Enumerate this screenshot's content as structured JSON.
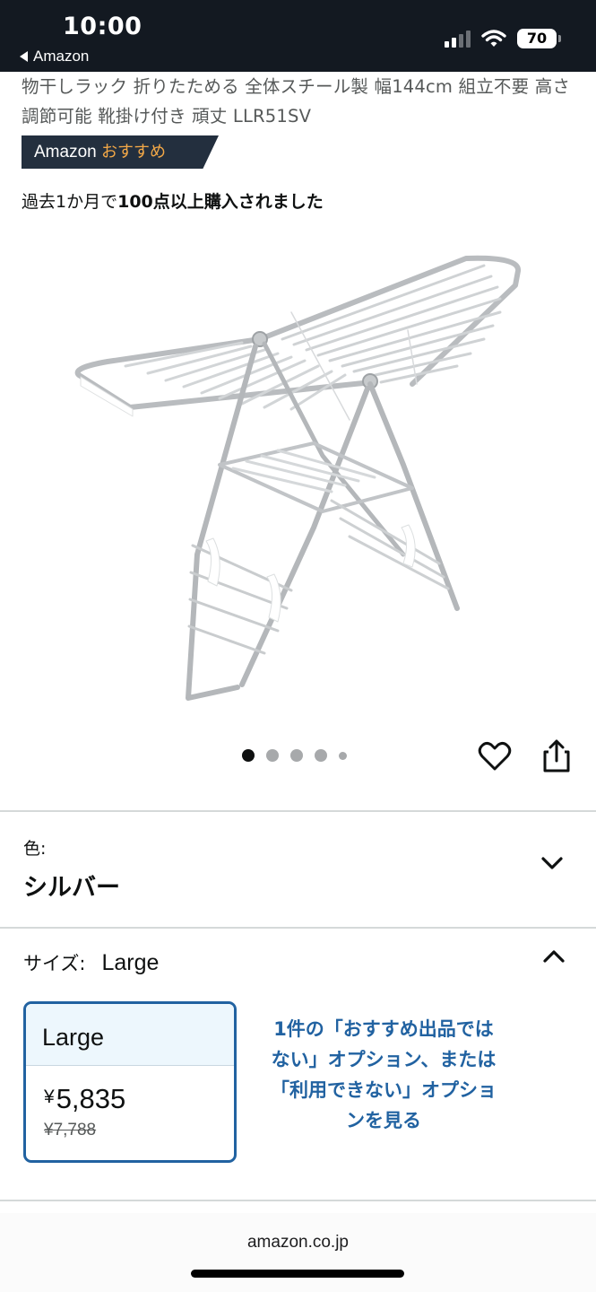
{
  "status_bar": {
    "time": "10:00",
    "back_label": "Amazon",
    "battery": "70"
  },
  "product": {
    "title": "物干しラック 折りたためる 全体スチール製 幅144cm 組立不要 高さ調節可能 靴掛け付き 頑丈 LLR51SV",
    "badge_prefix": "Amazon",
    "badge_accent": "おすすめ",
    "purchase_prefix": "過去1か月で",
    "purchase_bold": "100点以上購入されました",
    "image_icon": "drying-rack-image",
    "image_count": 5,
    "image_index": 0
  },
  "actions": {
    "heart_icon": "heart-icon",
    "share_icon": "share-icon"
  },
  "color_section": {
    "label": "色:",
    "value": "シルバー"
  },
  "size_section": {
    "label": "サイズ:",
    "value": "Large",
    "option": {
      "name": "Large",
      "currency": "¥",
      "price": "5,835",
      "original_price": "¥7,788"
    },
    "other_options_link": "1件の「おすすめ出品ではない」オプション、または「利用できない」オプションを見る"
  },
  "browser": {
    "domain": "amazon.co.jp"
  },
  "colors": {
    "header_bg": "#131921",
    "badge_bg": "#232f3e",
    "badge_accent": "#f3a847",
    "link": "#2162a1",
    "selected_card_bg": "#edf7fd"
  }
}
